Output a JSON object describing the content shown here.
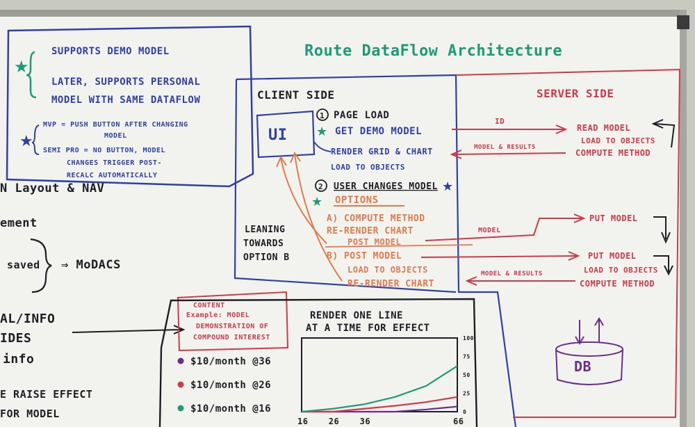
{
  "title": "Route DataFlow Architecture",
  "top_left_box": {
    "line1": "SUPPORTS DEMO MODEL",
    "line2": "LATER, SUPPORTS PERSONAL",
    "line3": "MODEL WITH SAME DATAFLOW",
    "line4": "MVP = PUSH BUTTON AFTER CHANGING",
    "line5": "MODEL",
    "line6": "SEMI PRO = NO BUTTON, MODEL",
    "line7": "CHANGES TRIGGER POST-",
    "line8": "RECALC AUTOMATICALLY"
  },
  "left_fragments": {
    "f1": "N Layout & NAV",
    "f2": "ement",
    "f3": "saved",
    "f4": "⇒ MoDACS",
    "f5": "AL/INFO",
    "f6": "IDES",
    "f7": "info",
    "f8": "E RAISE EFFECT",
    "f9": "FOR MODEL"
  },
  "client": {
    "heading": "CLIENT SIDE",
    "ui_box": "UI",
    "step1_num": "1",
    "step1_title": "PAGE LOAD",
    "get_demo": "GET DEMO MODEL",
    "render_grid": "RENDER GRID & CHART",
    "load_objects": "LOAD TO OBJECTS",
    "step2_num": "2",
    "step2_title": "USER CHANGES MODEL",
    "options": "OPTIONS",
    "optA1": "A) COMPUTE METHOD",
    "optA2": "RE-RENDER CHART",
    "optA3": "POST MODEL",
    "optB1": "B) POST MODEL",
    "optB2": "LOAD TO OBJECTS",
    "optB3": "RE-RENDER CHART",
    "leaning1": "LEANING",
    "leaning2": "TOWARDS",
    "leaning3": "OPTION B"
  },
  "server": {
    "heading": "SERVER SIDE",
    "read_model": "READ MODEL",
    "load_objects": "LOAD TO OBJECTS",
    "compute": "COMPUTE METHOD",
    "put_model_a": "PUT MODEL",
    "put_model_b": "PUT MODEL",
    "load_objects_b": "LOAD TO OBJECTS",
    "compute_b": "COMPUTE METHOD",
    "db": "DB"
  },
  "arrows": {
    "id": "ID",
    "model_results": "MODEL & RESULTS",
    "model": "MODEL",
    "model_results_b": "MODEL & RESULTS"
  },
  "content_note": {
    "line1": "CONTENT",
    "line2": "Example: MODEL",
    "line3": "DEMONSTRATION OF",
    "line4": "COMPOUND INTEREST"
  },
  "chart_note": {
    "line1": "RENDER ONE LINE",
    "line2": "AT A TIME FOR EFFECT"
  },
  "chart_data": {
    "type": "line",
    "x": [
      16,
      26,
      36,
      46,
      56,
      66
    ],
    "x_tick_labels": [
      "16",
      "26",
      "36",
      "",
      "66"
    ],
    "y_tick_labels": [
      "100",
      "75",
      "50",
      "25",
      "0"
    ],
    "ylim": [
      0,
      100
    ],
    "series": [
      {
        "name": "$10/month @36",
        "color": "#6b2d8a",
        "values": [
          0,
          0,
          0,
          0,
          3,
          7
        ]
      },
      {
        "name": "$10/month @26",
        "color": "#cf3949",
        "values": [
          0,
          0,
          4,
          8,
          13,
          20
        ]
      },
      {
        "name": "$10/month @16",
        "color": "#1d9a78",
        "values": [
          0,
          4,
          10,
          20,
          35,
          62
        ]
      }
    ]
  },
  "colors": {
    "blue": "#2f3fa8",
    "green": "#1d9a78",
    "red": "#cf3949",
    "orange": "#e07a4f",
    "black": "#1d1d24",
    "purple": "#6b2d8a"
  }
}
